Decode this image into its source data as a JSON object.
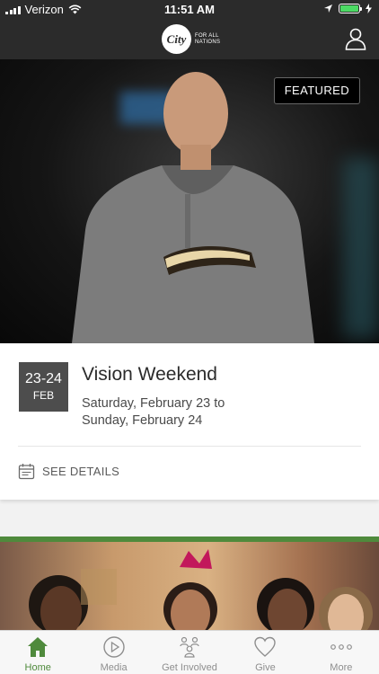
{
  "status_bar": {
    "carrier": "Verizon",
    "time": "11:51 AM"
  },
  "header": {
    "logo_word": "City",
    "logo_tagline_1": "FOR ALL",
    "logo_tagline_2": "NATIONS"
  },
  "hero": {
    "badge": "FEATURED"
  },
  "event": {
    "date_range": "23-24",
    "month": "FEB",
    "title": "Vision Weekend",
    "dates_line1": "Saturday, February 23 to",
    "dates_line2": "Sunday, February 24",
    "details_label": "SEE DETAILS"
  },
  "tabs": [
    {
      "label": "Home",
      "icon": "home-icon"
    },
    {
      "label": "Media",
      "icon": "play-icon"
    },
    {
      "label": "Get Involved",
      "icon": "people-icon"
    },
    {
      "label": "Give",
      "icon": "heart-icon"
    },
    {
      "label": "More",
      "icon": "more-icon"
    }
  ],
  "colors": {
    "bar_bg": "#2b2b2b",
    "accent": "#4f8a3c",
    "date_box": "#4d4d4d"
  }
}
